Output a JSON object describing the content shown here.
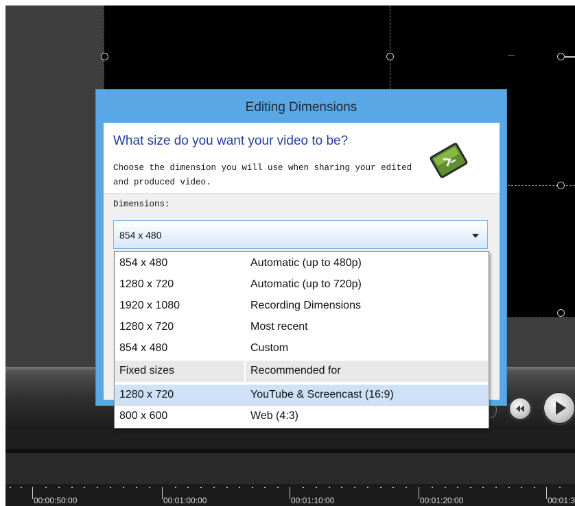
{
  "dialog": {
    "title": "Editing Dimensions",
    "question": "What size do you want your video to be?",
    "description": "Choose the dimension you will use when sharing your edited and produced video.",
    "dimensions_label": "Dimensions:",
    "selected_value": "854 x 480"
  },
  "dropdown": {
    "auto_items": [
      {
        "size": "854 x 480",
        "desc": "Automatic (up to 480p)"
      },
      {
        "size": "1280 x 720",
        "desc": "Automatic (up to 720p)"
      },
      {
        "size": "1920 x 1080",
        "desc": "Recording Dimensions"
      },
      {
        "size": "1280 x 720",
        "desc": "Most recent"
      },
      {
        "size": "854 x 480",
        "desc": "Custom"
      }
    ],
    "group_header": {
      "col1": "Fixed sizes",
      "col2": "Recommended for"
    },
    "fixed_items": [
      {
        "size": "1280 x 720",
        "desc": "YouTube & Screencast (16:9)",
        "highlighted": true
      },
      {
        "size": "800 x 600",
        "desc": "Web (4:3)",
        "highlighted": false
      }
    ]
  },
  "timeline": {
    "ruler_labels": [
      "00:00:50:00",
      "00:01:00:00",
      "00:01:10:00",
      "00:01:20:00",
      "00:01:3"
    ]
  },
  "colors": {
    "dialog_frame": "#5aa7e6",
    "header_title": "#1f3e98",
    "highlight": "#cfe1f7"
  },
  "icons": [
    "camtasia-logo-icon",
    "rewind-icon",
    "play-icon",
    "chevron-down-icon"
  ]
}
